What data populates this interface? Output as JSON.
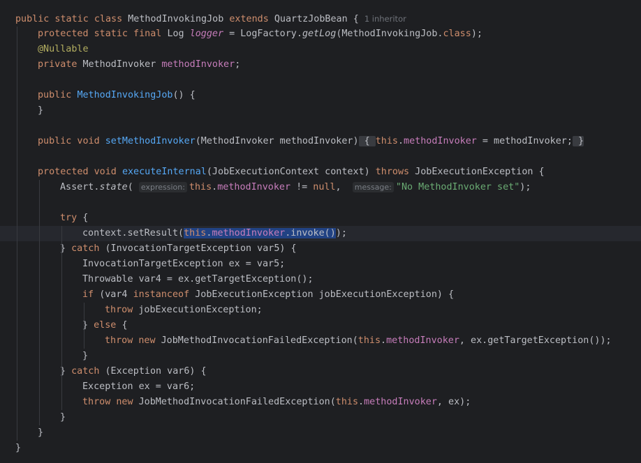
{
  "editor": {
    "lines": [
      {
        "segs": [
          [
            "kw",
            "public static class "
          ],
          [
            "",
            "MethodInvokingJob "
          ],
          [
            "kw",
            "extends "
          ],
          [
            "",
            "QuartzJobBean {"
          ]
        ],
        "inheritor": "1 inheritor"
      },
      {
        "indent": 1,
        "segs": [
          [
            "kw",
            "protected static final "
          ],
          [
            "",
            "Log "
          ],
          [
            "fieldI",
            "logger"
          ],
          [
            "",
            " = LogFactory."
          ],
          [
            "ital",
            "getLog"
          ],
          [
            "",
            "(MethodInvokingJob."
          ],
          [
            "kw",
            "class"
          ],
          [
            "",
            ");"
          ]
        ]
      },
      {
        "indent": 1,
        "segs": [
          [
            "ann",
            "@Nullable"
          ]
        ]
      },
      {
        "indent": 1,
        "segs": [
          [
            "kw",
            "private "
          ],
          [
            "",
            "MethodInvoker "
          ],
          [
            "field",
            "methodInvoker"
          ],
          [
            "",
            ";"
          ]
        ]
      },
      {
        "indent": 0,
        "segs": []
      },
      {
        "indent": 1,
        "segs": [
          [
            "kw",
            "public "
          ],
          [
            "fn",
            "MethodInvokingJob"
          ],
          [
            "",
            "() {"
          ]
        ]
      },
      {
        "indent": 1,
        "segs": [
          [
            "",
            "}"
          ]
        ]
      },
      {
        "indent": 0,
        "segs": []
      },
      {
        "indent": 1,
        "segs": [
          [
            "kw",
            "public void "
          ],
          [
            "fn",
            "setMethodInvoker"
          ],
          [
            "",
            "(MethodInvoker methodInvoker)"
          ],
          [
            "fold",
            " { "
          ],
          [
            "kw",
            "this"
          ],
          [
            "",
            "."
          ],
          [
            "field",
            "methodInvoker"
          ],
          [
            "",
            " = methodInvoker;"
          ],
          [
            "fold",
            " }"
          ]
        ]
      },
      {
        "indent": 0,
        "segs": []
      },
      {
        "indent": 1,
        "segs": [
          [
            "kw",
            "protected void "
          ],
          [
            "fn",
            "executeInternal"
          ],
          [
            "",
            "(JobExecutionContext context) "
          ],
          [
            "kw",
            "throws "
          ],
          [
            "",
            "JobExecutionException {"
          ]
        ]
      },
      {
        "indent": 2,
        "segs": [
          [
            "",
            "Assert."
          ],
          [
            "ital",
            "state"
          ],
          [
            "",
            "( "
          ],
          [
            "hint",
            "expression:"
          ],
          [
            "kw",
            "this"
          ],
          [
            "",
            "."
          ],
          [
            "field",
            "methodInvoker"
          ],
          [
            "",
            " != "
          ],
          [
            "kw",
            "null"
          ],
          [
            "",
            ",  "
          ],
          [
            "hint",
            "message:"
          ],
          [
            "str",
            "\"No MethodInvoker set\""
          ],
          [
            "",
            ");"
          ]
        ]
      },
      {
        "indent": 0,
        "segs": []
      },
      {
        "indent": 2,
        "segs": [
          [
            "kw",
            "try "
          ],
          [
            "",
            "{"
          ]
        ]
      },
      {
        "indent": 3,
        "current": true,
        "segs": [
          [
            "",
            "context.setResult("
          ],
          [
            "selkw",
            "this"
          ],
          [
            "sel",
            "."
          ],
          [
            "selfield",
            "methodInvoker"
          ],
          [
            "sel",
            ".invoke()"
          ],
          [
            "",
            ");"
          ]
        ]
      },
      {
        "indent": 2,
        "segs": [
          [
            "",
            "} "
          ],
          [
            "kw",
            "catch "
          ],
          [
            "",
            "(InvocationTargetException var5) {"
          ]
        ]
      },
      {
        "indent": 3,
        "segs": [
          [
            "",
            "InvocationTargetException ex = var5;"
          ]
        ]
      },
      {
        "indent": 3,
        "segs": [
          [
            "",
            "Throwable var4 = ex.getTargetException();"
          ]
        ]
      },
      {
        "indent": 3,
        "segs": [
          [
            "kw",
            "if "
          ],
          [
            "",
            "(var4 "
          ],
          [
            "kw",
            "instanceof "
          ],
          [
            "",
            "JobExecutionException jobExecutionException) {"
          ]
        ]
      },
      {
        "indent": 4,
        "segs": [
          [
            "kw",
            "throw "
          ],
          [
            "",
            "jobExecutionException;"
          ]
        ]
      },
      {
        "indent": 3,
        "segs": [
          [
            "",
            "} "
          ],
          [
            "kw",
            "else "
          ],
          [
            "",
            "{"
          ]
        ]
      },
      {
        "indent": 4,
        "segs": [
          [
            "kw",
            "throw new "
          ],
          [
            "",
            "JobMethodInvocationFailedException("
          ],
          [
            "kw",
            "this"
          ],
          [
            "",
            "."
          ],
          [
            "field",
            "methodInvoker"
          ],
          [
            "",
            ", ex.getTargetException());"
          ]
        ]
      },
      {
        "indent": 3,
        "segs": [
          [
            "",
            "}"
          ]
        ]
      },
      {
        "indent": 2,
        "segs": [
          [
            "",
            "} "
          ],
          [
            "kw",
            "catch "
          ],
          [
            "",
            "(Exception var6) {"
          ]
        ]
      },
      {
        "indent": 3,
        "segs": [
          [
            "",
            "Exception ex = var6;"
          ]
        ]
      },
      {
        "indent": 3,
        "segs": [
          [
            "kw",
            "throw new "
          ],
          [
            "",
            "JobMethodInvocationFailedException("
          ],
          [
            "kw",
            "this"
          ],
          [
            "",
            "."
          ],
          [
            "field",
            "methodInvoker"
          ],
          [
            "",
            ", ex);"
          ]
        ]
      },
      {
        "indent": 2,
        "segs": [
          [
            "",
            "}"
          ]
        ]
      },
      {
        "indent": 1,
        "segs": [
          [
            "",
            "}"
          ]
        ]
      },
      {
        "indent": 0,
        "segs": [
          [
            "",
            "}"
          ]
        ]
      }
    ]
  },
  "colors": {
    "background": "#1e1f22",
    "keyword": "#cf8e6d",
    "field": "#c77dbb",
    "function": "#56a8f5",
    "string": "#6aab73",
    "annotation": "#b3ae60",
    "selection": "#214283"
  }
}
